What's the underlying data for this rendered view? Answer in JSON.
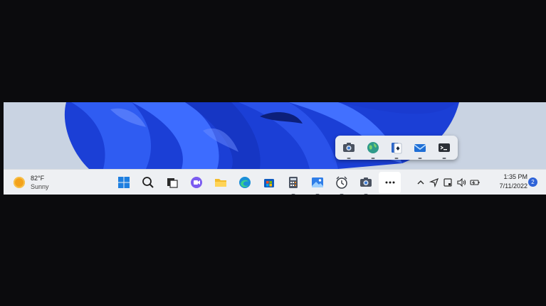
{
  "weather": {
    "temperature": "82°F",
    "condition": "Sunny"
  },
  "taskbar": {
    "pinned": [
      {
        "name": "start-button",
        "icon": "windows-logo-icon"
      },
      {
        "name": "search-button",
        "icon": "search-icon"
      },
      {
        "name": "task-view-button",
        "icon": "task-view-icon"
      },
      {
        "name": "chat-button",
        "icon": "teams-chat-icon"
      },
      {
        "name": "file-explorer-button",
        "icon": "folder-icon"
      },
      {
        "name": "edge-button",
        "icon": "edge-icon"
      },
      {
        "name": "store-button",
        "icon": "store-icon"
      },
      {
        "name": "calculator-button",
        "icon": "calculator-icon",
        "running": true
      },
      {
        "name": "photos-button",
        "icon": "photos-icon",
        "running": true
      },
      {
        "name": "clock-app-button",
        "icon": "alarm-clock-icon",
        "running": true
      },
      {
        "name": "camera-button",
        "icon": "camera-icon",
        "running": true
      },
      {
        "name": "overflow-button",
        "icon": "more-icon",
        "active": true
      }
    ]
  },
  "overflow_flyout": {
    "items": [
      {
        "name": "camera",
        "icon": "camera-icon"
      },
      {
        "name": "maps",
        "icon": "globe-icon"
      },
      {
        "name": "solitaire",
        "icon": "cards-icon"
      },
      {
        "name": "mail",
        "icon": "mail-icon"
      },
      {
        "name": "terminal",
        "icon": "terminal-icon"
      }
    ]
  },
  "tray": {
    "icons": [
      "chevron-up-icon",
      "location-icon",
      "tablet-icon",
      "volume-icon",
      "battery-icon"
    ]
  },
  "clock": {
    "time": "1:35 PM",
    "date": "7/11/2022"
  },
  "notifications": {
    "count": "2"
  },
  "colors": {
    "accent": "#2e63d8",
    "wallpaper_blue": "#1f47e0",
    "taskbar": "#eef0f3"
  }
}
